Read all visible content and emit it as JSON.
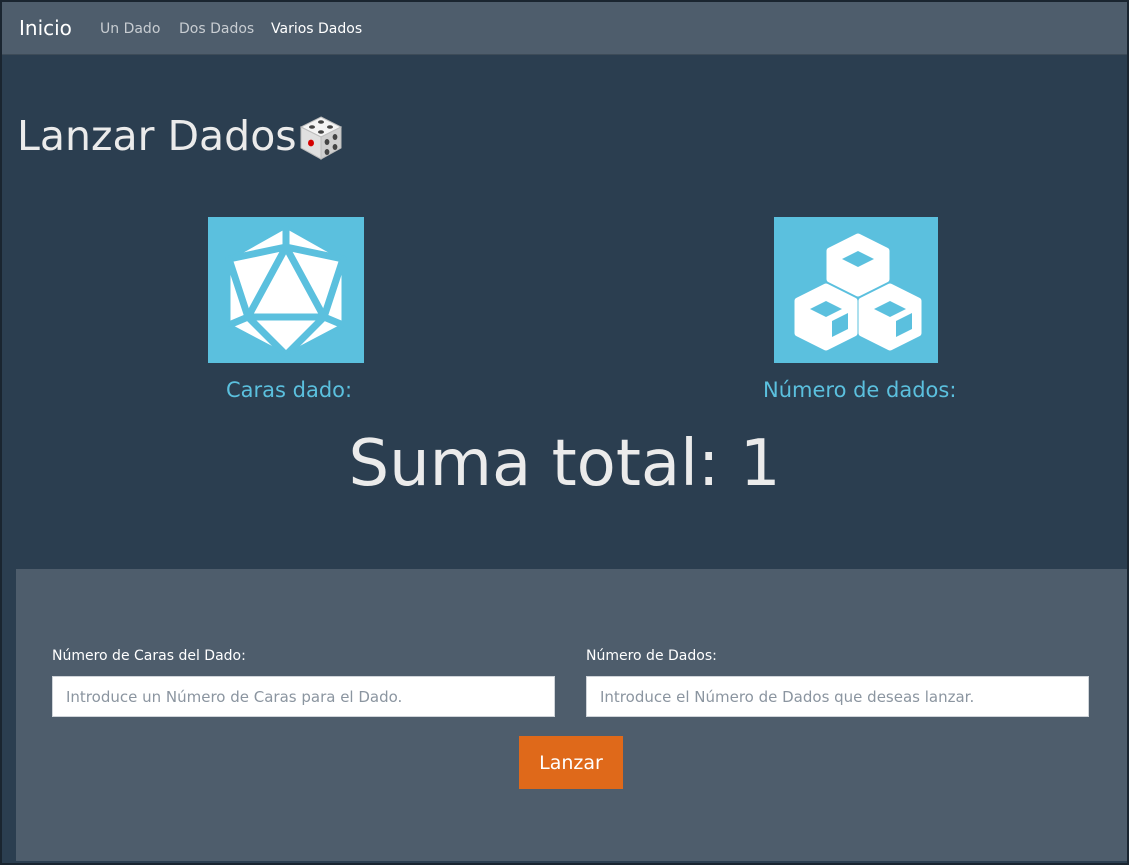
{
  "navbar": {
    "brand": "Inicio",
    "links": [
      {
        "label": "Un Dado",
        "active": false
      },
      {
        "label": "Dos Dados",
        "active": false
      },
      {
        "label": "Varios Dados",
        "active": true
      }
    ]
  },
  "main": {
    "title": "Lanzar Dados",
    "title_icon": "die-emoji-icon",
    "tiles": [
      {
        "icon": "d20-icon",
        "caption": "Caras dado:"
      },
      {
        "icon": "stacked-cubes-icon",
        "caption": "Número de dados:"
      }
    ],
    "sum_total": "Suma total: 1"
  },
  "form": {
    "caras_label": "Número de Caras del Dado:",
    "caras_placeholder": "Introduce un Número de Caras para el Dado.",
    "dados_label": "Número de Dados:",
    "dados_placeholder": "Introduce el Número de Dados que deseas lanzar.",
    "submit_label": "Lanzar"
  },
  "colors": {
    "background": "#2b3e50",
    "navbar": "#4e5d6c",
    "accent_info": "#5bc0de",
    "button_primary": "#df691a"
  }
}
